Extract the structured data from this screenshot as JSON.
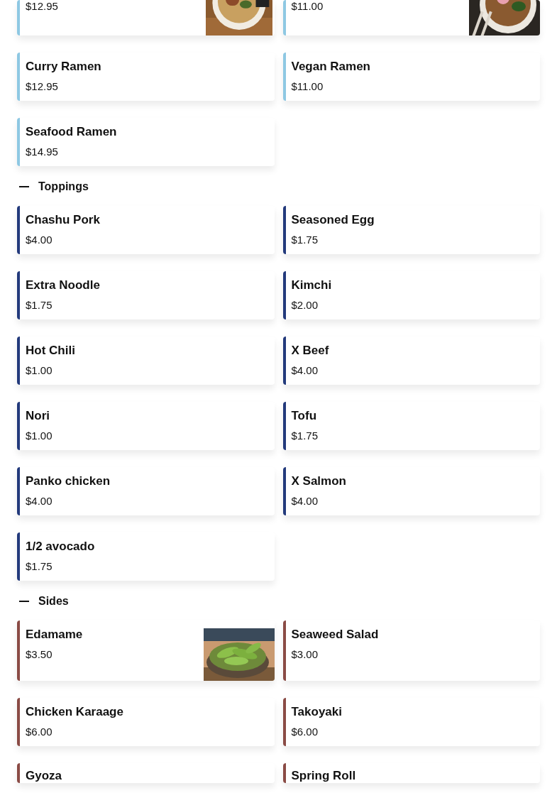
{
  "sections": [
    {
      "color": "#8ec8e3",
      "items": [
        {
          "price": "$12.95"
        },
        {
          "price": "$11.00"
        },
        {
          "name": "Curry Ramen",
          "price": "$12.95"
        },
        {
          "name": "Vegan Ramen",
          "price": "$11.00"
        },
        {
          "name": "Seafood Ramen",
          "price": "$14.95"
        }
      ]
    },
    {
      "title": "Toppings",
      "expanded": true,
      "color": "#233a7c",
      "items": [
        {
          "name": "Chashu Pork",
          "price": "$4.00"
        },
        {
          "name": "Seasoned Egg",
          "price": "$1.75"
        },
        {
          "name": "Extra Noodle",
          "price": "$1.75"
        },
        {
          "name": "Kimchi",
          "price": "$2.00"
        },
        {
          "name": "Hot Chili",
          "price": "$1.00"
        },
        {
          "name": "X Beef",
          "price": "$4.00"
        },
        {
          "name": "Nori",
          "price": "$1.00"
        },
        {
          "name": "Tofu",
          "price": "$1.75"
        },
        {
          "name": "Panko chicken",
          "price": "$4.00"
        },
        {
          "name": "X Salmon",
          "price": "$4.00"
        },
        {
          "name": "1/2 avocado",
          "price": "$1.75"
        }
      ]
    },
    {
      "title": "Sides",
      "expanded": true,
      "color": "#8a4b45",
      "items": [
        {
          "name": "Edamame",
          "price": "$3.50"
        },
        {
          "name": "Seaweed Salad",
          "price": "$3.00"
        },
        {
          "name": "Chicken Karaage",
          "price": "$6.00"
        },
        {
          "name": "Takoyaki",
          "price": "$6.00"
        },
        {
          "name": "Gyoza"
        },
        {
          "name": "Spring Roll"
        }
      ]
    }
  ]
}
